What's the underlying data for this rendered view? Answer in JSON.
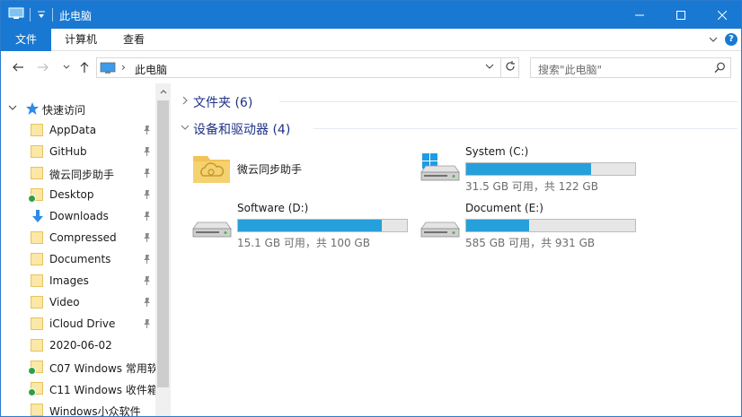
{
  "window": {
    "title": "此电脑",
    "controls": {
      "minimize": "minimize",
      "maximize": "maximize",
      "close": "close"
    }
  },
  "ribbon": {
    "tabs": [
      {
        "label": "文件",
        "active": true
      },
      {
        "label": "计算机",
        "active": false
      },
      {
        "label": "查看",
        "active": false
      }
    ],
    "help": "?"
  },
  "address_bar": {
    "path": "此电脑",
    "search_placeholder": "搜索\"此电脑\""
  },
  "sidebar": {
    "quick_access": "快速访问",
    "items": [
      {
        "label": "AppData",
        "icon": "folder-icon",
        "pinned": true,
        "synced": false
      },
      {
        "label": "GitHub",
        "icon": "folder-icon",
        "pinned": true,
        "synced": false
      },
      {
        "label": "微云同步助手",
        "icon": "folder-icon",
        "pinned": true,
        "synced": false
      },
      {
        "label": "Desktop",
        "icon": "folder-icon",
        "pinned": true,
        "synced": true
      },
      {
        "label": "Downloads",
        "icon": "download-icon",
        "pinned": true,
        "synced": false
      },
      {
        "label": "Compressed",
        "icon": "folder-icon",
        "pinned": true,
        "synced": false
      },
      {
        "label": "Documents",
        "icon": "folder-icon",
        "pinned": true,
        "synced": false
      },
      {
        "label": "Images",
        "icon": "folder-icon",
        "pinned": true,
        "synced": false
      },
      {
        "label": "Video",
        "icon": "folder-icon",
        "pinned": true,
        "synced": false
      },
      {
        "label": "iCloud Drive",
        "icon": "folder-icon",
        "pinned": true,
        "synced": false
      },
      {
        "label": "2020-06-02",
        "icon": "folder-icon",
        "pinned": false,
        "synced": false
      },
      {
        "label": "C07 Windows 常用软",
        "icon": "folder-icon",
        "pinned": false,
        "synced": true
      },
      {
        "label": "C11 Windows 收件箱",
        "icon": "folder-icon",
        "pinned": false,
        "synced": true
      },
      {
        "label": "Windows小众软件",
        "icon": "folder-icon",
        "pinned": false,
        "synced": false
      }
    ]
  },
  "main": {
    "groups": [
      {
        "label": "文件夹 (6)",
        "expanded": false
      },
      {
        "label": "设备和驱动器 (4)",
        "expanded": true
      }
    ],
    "devices": [
      {
        "name": "微云同步助手",
        "type": "app",
        "has_bar": false
      },
      {
        "name": "System (C:)",
        "type": "windows-drive",
        "has_bar": true,
        "used_fraction": 0.742,
        "free_text": "31.5 GB 可用，共 122 GB"
      },
      {
        "name": "Software (D:)",
        "type": "drive",
        "has_bar": true,
        "used_fraction": 0.849,
        "free_text": "15.1 GB 可用，共 100 GB"
      },
      {
        "name": "Document (E:)",
        "type": "drive",
        "has_bar": true,
        "used_fraction": 0.372,
        "free_text": "585 GB 可用，共 931 GB"
      }
    ]
  },
  "colors": {
    "accent": "#1979d2",
    "bar_fill": "#26a0da",
    "group_header": "#1e3287"
  }
}
